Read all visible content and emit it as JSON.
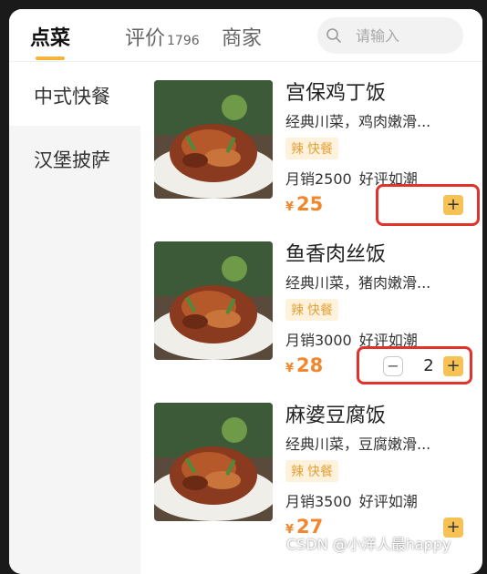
{
  "header": {
    "tabs": [
      {
        "label": "点菜",
        "active": true
      },
      {
        "label": "评价",
        "count": "1796"
      },
      {
        "label": "商家"
      }
    ],
    "search": {
      "placeholder": "请输入",
      "icon": "search-icon"
    },
    "accent_color": "#f5b53c"
  },
  "sidebar": {
    "items": [
      {
        "label": "中式快餐",
        "active": true
      },
      {
        "label": "汉堡披萨"
      }
    ]
  },
  "dishes": [
    {
      "name": "宫保鸡丁饭",
      "desc": "经典川菜，鸡肉嫩滑...",
      "tags": [
        "辣",
        "快餐"
      ],
      "sales": "月销2500",
      "rating": "好评如潮",
      "currency": "¥",
      "price": "25",
      "quantity": null
    },
    {
      "name": "鱼香肉丝饭",
      "desc": "经典川菜，猪肉嫩滑...",
      "tags": [
        "辣",
        "快餐"
      ],
      "sales": "月销3000",
      "rating": "好评如潮",
      "currency": "¥",
      "price": "28",
      "quantity": "2"
    },
    {
      "name": "麻婆豆腐饭",
      "desc": "经典川菜，豆腐嫩滑...",
      "tags": [
        "辣",
        "快餐"
      ],
      "sales": "月销3500",
      "rating": "好评如潮",
      "currency": "¥",
      "price": "27",
      "quantity": null
    }
  ],
  "stepper": {
    "add_symbol": "+",
    "minus_symbol": "−"
  },
  "price_color": "#f0872d",
  "highlight_color": "#e0332c",
  "watermark": "CSDN @小洋人最happy"
}
